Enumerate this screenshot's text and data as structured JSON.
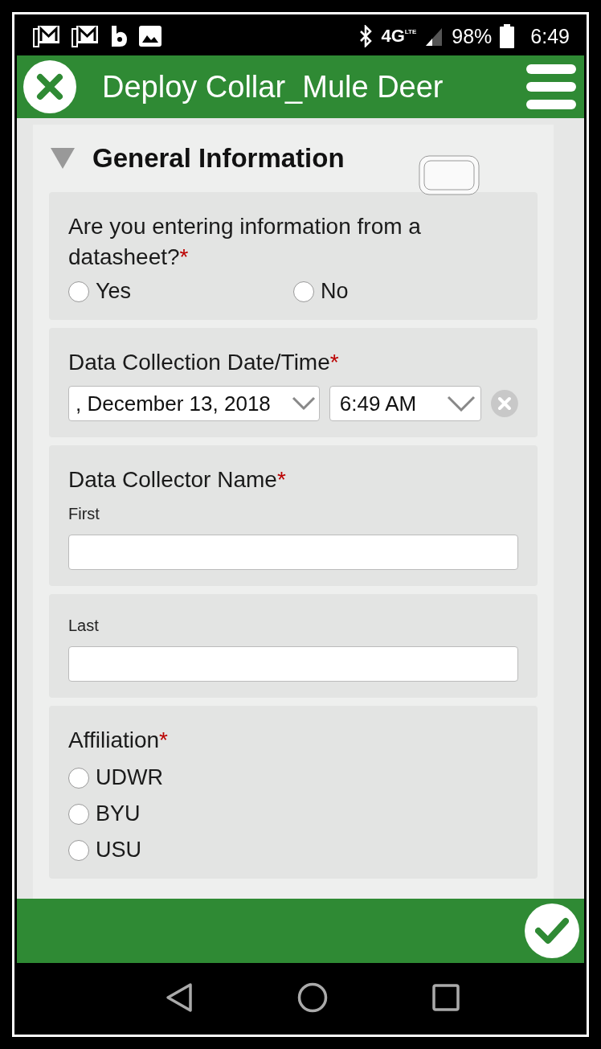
{
  "status_bar": {
    "network": "4G",
    "network_sub": "LTE",
    "battery": "98%",
    "time": "6:49"
  },
  "header": {
    "title": "Deploy Collar_Mule Deer"
  },
  "section": {
    "title": "General Information",
    "expanded": true
  },
  "questions": [
    {
      "kind": "radio_row",
      "label": "Are you entering information from a datasheet?",
      "required_mark": "*",
      "options": [
        {
          "label": "Yes",
          "selected": false
        },
        {
          "label": "No",
          "selected": false
        }
      ]
    },
    {
      "kind": "datetime",
      "label": "Data Collection Date/Time",
      "required_mark": "*",
      "date": ", December 13, 2018",
      "time": "6:49 AM"
    },
    {
      "kind": "text",
      "label": "Data Collector Name",
      "required_mark": "*",
      "sublabel": "First"
    },
    {
      "kind": "text",
      "sublabel": "Last"
    },
    {
      "kind": "radio_column",
      "label": "Affiliation",
      "required_mark": "*",
      "options": [
        {
          "label": "UDWR",
          "selected": false
        },
        {
          "label": "BYU",
          "selected": false
        },
        {
          "label": "USU",
          "selected": false
        }
      ]
    }
  ]
}
